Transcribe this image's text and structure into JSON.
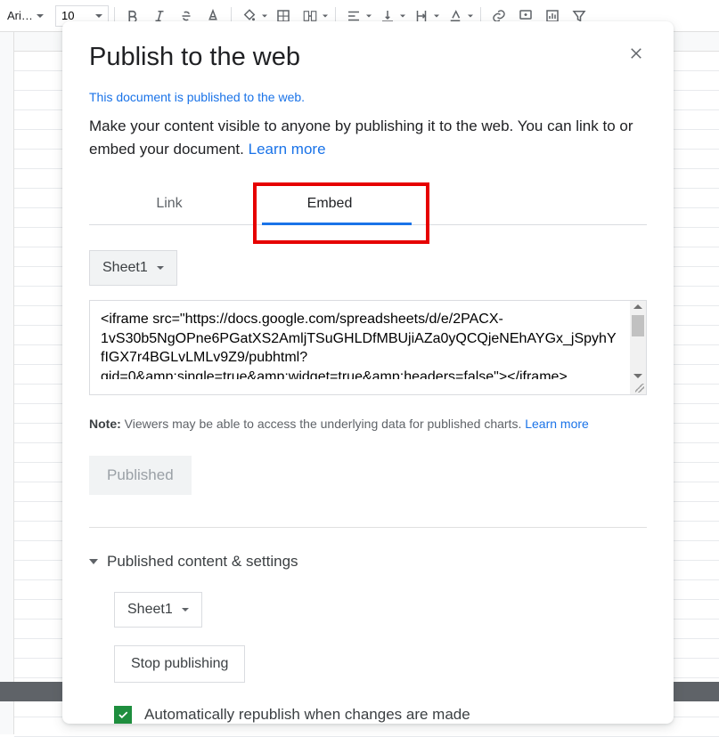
{
  "toolbar": {
    "font_name": "Ari…",
    "font_size": "10"
  },
  "modal": {
    "title": "Publish to the web",
    "status": "This document is published to the web.",
    "description_1": "Make your content visible to anyone by publishing it to the web. You can link to or embed your document. ",
    "learn_more": "Learn more",
    "tabs": {
      "link": "Link",
      "embed": "Embed"
    },
    "sheet_selector_1": "Sheet1",
    "embed_code": "<iframe src=\"https://docs.google.com/spreadsheets/d/e/2PACX-1vS30b5NgOPne6PGatXS2AmljTSuGHLDfMBUjiAZa0yQCQjeNEhAYGx_jSpyhYfIGX7r4BGLvLMLv9Z9/pubhtml?gid=0&amp;single=true&amp;widget=true&amp;headers=false\"></iframe>",
    "note_label": "Note:",
    "note_text": " Viewers may be able to access the underlying data for published charts. ",
    "published_btn": "Published",
    "settings_header": "Published content & settings",
    "sheet_selector_2": "Sheet1",
    "stop_btn": "Stop publishing",
    "auto_republish": "Automatically republish when changes are made"
  }
}
